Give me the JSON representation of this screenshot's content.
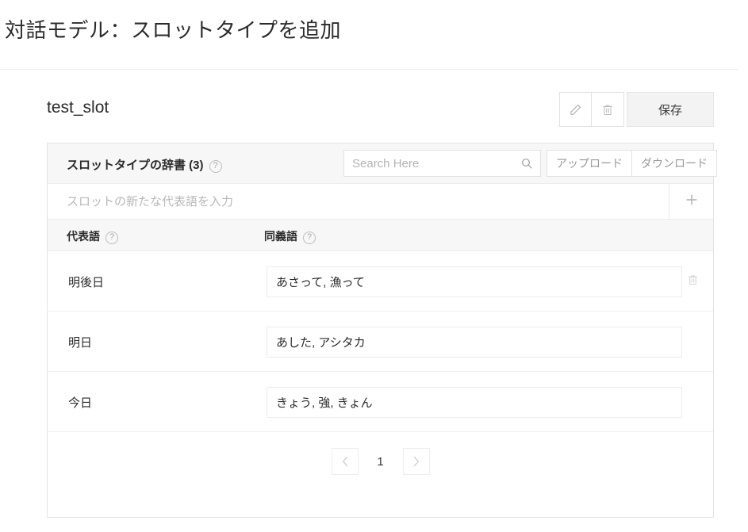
{
  "page": {
    "title": "対話モデル：スロットタイプを追加"
  },
  "slot": {
    "name": "test_slot",
    "edit_icon": "pencil-icon",
    "delete_icon": "trash-icon",
    "save_label": "保存"
  },
  "dictionary": {
    "title": "スロットタイプの辞書 (3)",
    "help_glyph": "?",
    "search": {
      "placeholder": "Search Here",
      "value": "",
      "icon": "search-icon"
    },
    "upload_label": "アップロード",
    "download_label": "ダウンロード",
    "new_entry": {
      "placeholder": "スロットの新たな代表語を入力",
      "value": "",
      "add_glyph": "+"
    },
    "columns": {
      "term": "代表語",
      "synonyms": "同義語"
    },
    "rows": [
      {
        "term": "明後日",
        "synonyms": "あさって, 漁って",
        "show_delete": true
      },
      {
        "term": "明日",
        "synonyms": "あした, アシタカ",
        "show_delete": false
      },
      {
        "term": "今日",
        "synonyms": "きょう, 強, きょん",
        "show_delete": false
      }
    ],
    "pagination": {
      "prev_glyph": "‹",
      "page": "1",
      "next_glyph": "›"
    }
  },
  "colors": {
    "text": "#2b2b2b",
    "muted": "#9a9a9a",
    "border": "#e3e3e3",
    "header_bg": "#f7f7f7",
    "save_bg": "#f3f3f3"
  }
}
